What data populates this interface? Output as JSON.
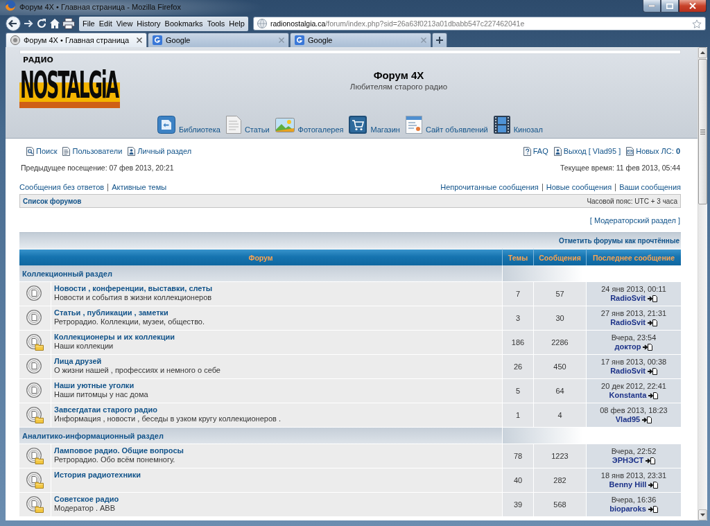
{
  "window": {
    "title": "Форум 4X • Главная страница - Mozilla Firefox"
  },
  "menu": [
    "File",
    "Edit",
    "View",
    "History",
    "Bookmarks",
    "Tools",
    "Help"
  ],
  "address_bar": {
    "host": "radionostalgia.ca",
    "path": "/forum/index.php?sid=26a63f0213a01dbabb547c227462041e"
  },
  "tabs": [
    {
      "label": "Форум 4X • Главная страница",
      "kind": "site",
      "selected": true
    },
    {
      "label": "Google",
      "kind": "google",
      "selected": false
    },
    {
      "label": "Google",
      "kind": "google",
      "selected": false
    }
  ],
  "header": {
    "logo_small": "РАДИО",
    "logo_main": "NOSTALGiA",
    "title": "Форум 4X",
    "subtitle": "Любителям старого радио"
  },
  "site_nav": [
    {
      "label": "Библиотека",
      "kind": "library"
    },
    {
      "label": "Статьи",
      "kind": "articles"
    },
    {
      "label": "Фотогалерея",
      "kind": "gallery"
    },
    {
      "label": "Магазин",
      "kind": "shop"
    },
    {
      "label": "Сайт объявлений",
      "kind": "ads"
    },
    {
      "label": "Кинозал",
      "kind": "cinema"
    }
  ],
  "user_links_left": [
    {
      "label": "Поиск",
      "kind": "search"
    },
    {
      "label": "Пользователи",
      "kind": "members"
    },
    {
      "label": "Личный раздел",
      "kind": "profile"
    }
  ],
  "user_links_right": [
    {
      "label": "FAQ",
      "kind": "faq"
    },
    {
      "label": "Выход [ Vlad95 ]",
      "kind": "logout"
    },
    {
      "label": "Новых ЛС: **0**",
      "kind": "inbox"
    }
  ],
  "last_visit": "Предыдущее посещение: 07 фев 2013, 20:21",
  "current_time": "Текущее время: 11 фев 2013, 05:44",
  "quick_links_left": [
    "Сообщения без ответов",
    "Активные темы"
  ],
  "quick_links_right": [
    "Непрочитанные сообщения",
    "Новые сообщения",
    "Ваши сообщения"
  ],
  "breadcrumb": "Список форумов",
  "timezone": "Часовой пояс: UTC + 3 часа",
  "moderator_link": "[ Модераторский раздел ]",
  "mark_read": "Отметить форумы как прочтённые",
  "columns": [
    "Форум",
    "Темы",
    "Сообщения",
    "Последнее сообщение"
  ],
  "categories": [
    {
      "title": "Коллекционный раздел",
      "forums": [
        {
          "title": "Новости , конференции, выставки, слеты",
          "description": "Новости и события в жизни коллекционеров",
          "topics": "7",
          "posts": "57",
          "last_post_time": "24 янв 2013, 00:11",
          "last_post_author": "RadioSvit",
          "new_posts": false
        },
        {
          "title": "Статьи , публикации , заметки",
          "description": "Ретрорадио. Коллекции, музеи, общество.",
          "topics": "3",
          "posts": "30",
          "last_post_time": "27 янв 2013, 21:31",
          "last_post_author": "RadioSvit",
          "new_posts": false
        },
        {
          "title": "Коллекционеры и их коллекции",
          "description": "Наши коллекции",
          "topics": "186",
          "posts": "2286",
          "last_post_time": "Вчера, 23:54",
          "last_post_author": "доктор",
          "new_posts": true
        },
        {
          "title": "Лица друзей",
          "description": "О жизни нашей , профессиях и немного о себе",
          "topics": "26",
          "posts": "450",
          "last_post_time": "17 янв 2013, 00:38",
          "last_post_author": "RadioSvit",
          "new_posts": false
        },
        {
          "title": "Наши уютные уголки",
          "description": "Наши питомцы у нас дома",
          "topics": "5",
          "posts": "64",
          "last_post_time": "20 дек 2012, 22:41",
          "last_post_author": "Konstanta",
          "new_posts": false
        },
        {
          "title": "Завсегдатаи старого радио",
          "description": "Информация , новости , беседы в узком кругу коллекционеров .",
          "topics": "1",
          "posts": "4",
          "last_post_time": "08 фев 2013, 18:23",
          "last_post_author": "Vlad95",
          "new_posts": true
        }
      ]
    },
    {
      "title": "Аналитико-информационный раздел",
      "forums": [
        {
          "title": "Ламповое радио. Общие вопросы",
          "description": "Ретрорадио. Обо всём понемногу.",
          "topics": "78",
          "posts": "1223",
          "last_post_time": "Вчера, 22:52",
          "last_post_author": "ЭРНЭСТ",
          "new_posts": true
        },
        {
          "title": "История радиотехники",
          "topics": "40",
          "posts": "282",
          "last_post_time": "18 янв 2013, 23:31",
          "last_post_author": "Benny Hill",
          "new_posts": true
        },
        {
          "title": "Советское радио",
          "description": "Модератор . ABB",
          "topics": "39",
          "posts": "568",
          "last_post_time": "Вчера, 16:36",
          "last_post_author": "bioparoks",
          "new_posts": true
        }
      ]
    }
  ]
}
